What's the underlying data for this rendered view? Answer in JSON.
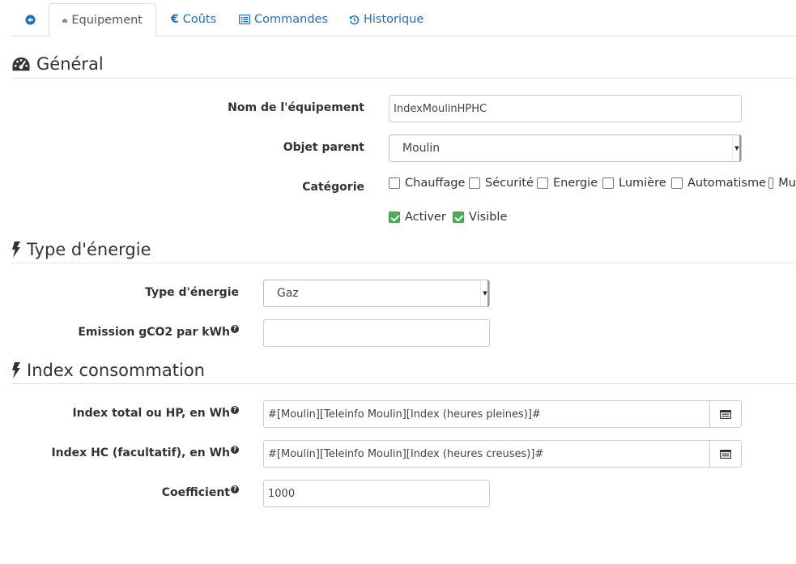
{
  "tabs": [
    {
      "label": "",
      "icon": "arrow-circle-left-icon"
    },
    {
      "label": "Equipement",
      "icon": "tachometer-icon"
    },
    {
      "label": "Coûts",
      "icon": "euro-icon"
    },
    {
      "label": "Commandes",
      "icon": "list-alt-icon"
    },
    {
      "label": "Historique",
      "icon": "history-icon"
    }
  ],
  "general": {
    "title": "Général",
    "name_label": "Nom de l'équipement",
    "name_value": "IndexMoulinHPHC",
    "parent_label": "Objet parent",
    "parent_value": "Moulin",
    "category_label": "Catégorie",
    "categories": [
      "Chauffage",
      "Sécurité",
      "Energie",
      "Lumière",
      "Automatisme",
      "Mu"
    ],
    "activer": "Activer",
    "visible": "Visible"
  },
  "energy": {
    "title": "Type d'énergie",
    "type_label": "Type d'énergie",
    "type_value": "Gaz",
    "emission_label": "Emission gCO2 par kWh",
    "emission_value": ""
  },
  "index": {
    "title": "Index consommation",
    "hp_label": "Index total ou HP, en Wh",
    "hp_value": "#[Moulin][Teleinfo Moulin][Index (heures pleines)]#",
    "hc_label": "Index HC (facultatif), en Wh",
    "hc_value": "#[Moulin][Teleinfo Moulin][Index (heures creuses)]#",
    "coef_label": "Coefficient",
    "coef_value": "1000"
  },
  "help_glyph": "?",
  "colors": {
    "link": "#1f6fb5",
    "checked": "#4caf50"
  }
}
